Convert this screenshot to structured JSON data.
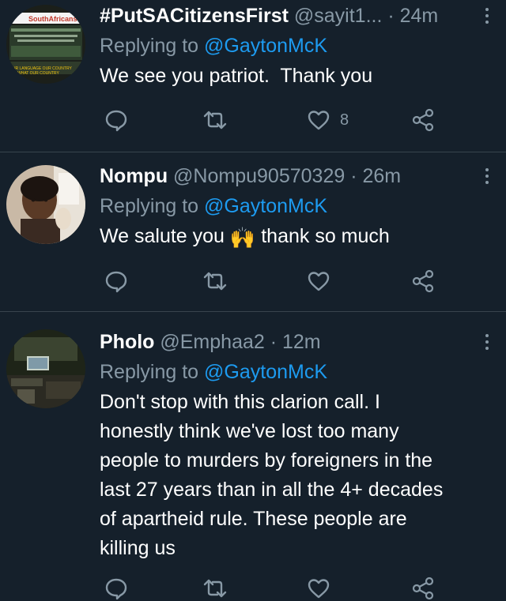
{
  "tweets": [
    {
      "display_name": "#PutSACitizensFirst",
      "handle_time": " @sayit1... · 24m",
      "replying_label": "Replying to ",
      "replying_to": "@GaytonMcK",
      "text": "We see you patriot.  Thank you",
      "like_count": "8",
      "avatar_text": {
        "top": "SouthAfricans",
        "bottom1": "OUR LANGUAGE OUR COUNTRY",
        "bottom2": "WHAT OUR COUNTRY"
      }
    },
    {
      "display_name": "Nompu",
      "handle_time": " @Nompu90570329 · 26m",
      "replying_label": "Replying to ",
      "replying_to": "@GaytonMcK",
      "text_before": "We salute you ",
      "emoji": "🙌",
      "text_after": " thank so much",
      "like_count": ""
    },
    {
      "display_name": "Pholo",
      "handle_time": " @Emphaa2 · 12m",
      "replying_label": "Replying to ",
      "replying_to": "@GaytonMcK",
      "text": "Don't stop with this clarion call. I\nhonestly think we've lost too many\npeople to murders by foreigners in the\nlast 27 years than in all the 4+ decades\nof apartheid rule. These people are\nkilling us",
      "like_count": ""
    }
  ],
  "colors": {
    "background": "#15202b",
    "secondary_text": "#8899a6",
    "link": "#1d9bf0",
    "divider": "#38444d"
  },
  "icons": [
    "reply-icon",
    "retweet-icon",
    "like-icon",
    "share-icon",
    "more-icon"
  ]
}
